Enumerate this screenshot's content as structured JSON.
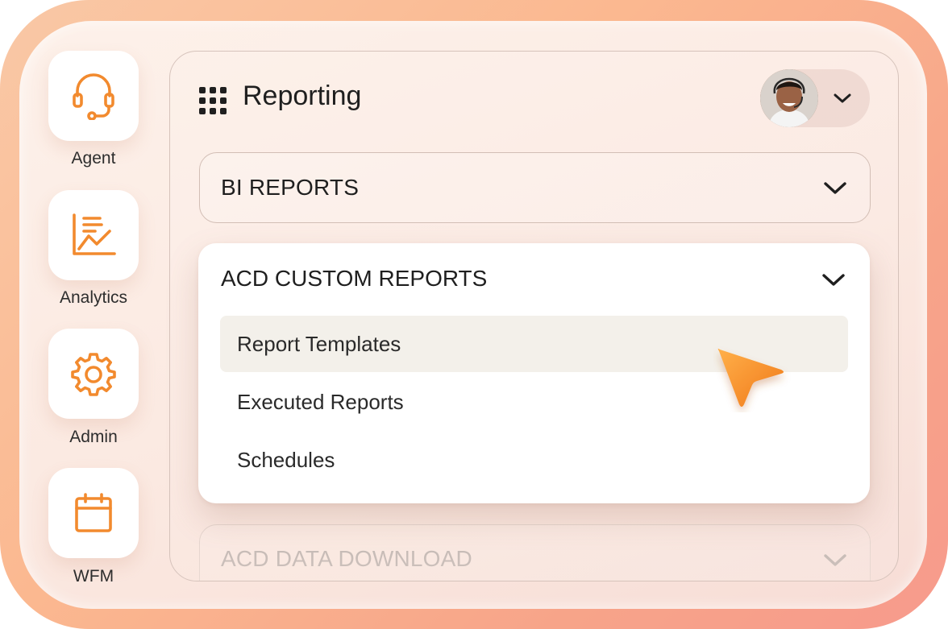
{
  "sidebar": {
    "items": [
      {
        "label": "Agent",
        "icon": "headset-icon"
      },
      {
        "label": "Analytics",
        "icon": "chart-icon"
      },
      {
        "label": "Admin",
        "icon": "gear-icon"
      },
      {
        "label": "WFM",
        "icon": "calendar-icon"
      }
    ]
  },
  "header": {
    "title": "Reporting",
    "menu_icon": "app-grid-icon"
  },
  "user": {
    "avatar_icon": "avatar",
    "menu_icon": "chevron-down-icon"
  },
  "sections": {
    "bi_reports": {
      "label": "BI REPORTS"
    },
    "acd_custom_reports": {
      "label": "ACD CUSTOM REPORTS",
      "items": [
        {
          "label": "Report Templates",
          "selected": true
        },
        {
          "label": "Executed Reports",
          "selected": false
        },
        {
          "label": "Schedules",
          "selected": false
        }
      ]
    },
    "acd_data_download": {
      "label": "ACD DATA DOWNLOAD"
    }
  },
  "colors": {
    "accent": "#f28a2e",
    "accent_dark": "#f07818",
    "text": "#1f1f1f"
  }
}
